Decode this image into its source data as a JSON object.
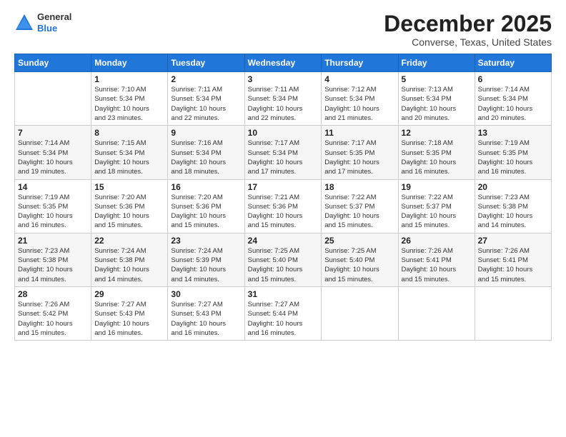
{
  "logo": {
    "general": "General",
    "blue": "Blue"
  },
  "title": "December 2025",
  "subtitle": "Converse, Texas, United States",
  "days_header": [
    "Sunday",
    "Monday",
    "Tuesday",
    "Wednesday",
    "Thursday",
    "Friday",
    "Saturday"
  ],
  "weeks": [
    [
      {
        "num": "",
        "info": ""
      },
      {
        "num": "1",
        "info": "Sunrise: 7:10 AM\nSunset: 5:34 PM\nDaylight: 10 hours\nand 23 minutes."
      },
      {
        "num": "2",
        "info": "Sunrise: 7:11 AM\nSunset: 5:34 PM\nDaylight: 10 hours\nand 22 minutes."
      },
      {
        "num": "3",
        "info": "Sunrise: 7:11 AM\nSunset: 5:34 PM\nDaylight: 10 hours\nand 22 minutes."
      },
      {
        "num": "4",
        "info": "Sunrise: 7:12 AM\nSunset: 5:34 PM\nDaylight: 10 hours\nand 21 minutes."
      },
      {
        "num": "5",
        "info": "Sunrise: 7:13 AM\nSunset: 5:34 PM\nDaylight: 10 hours\nand 20 minutes."
      },
      {
        "num": "6",
        "info": "Sunrise: 7:14 AM\nSunset: 5:34 PM\nDaylight: 10 hours\nand 20 minutes."
      }
    ],
    [
      {
        "num": "7",
        "info": "Sunrise: 7:14 AM\nSunset: 5:34 PM\nDaylight: 10 hours\nand 19 minutes."
      },
      {
        "num": "8",
        "info": "Sunrise: 7:15 AM\nSunset: 5:34 PM\nDaylight: 10 hours\nand 18 minutes."
      },
      {
        "num": "9",
        "info": "Sunrise: 7:16 AM\nSunset: 5:34 PM\nDaylight: 10 hours\nand 18 minutes."
      },
      {
        "num": "10",
        "info": "Sunrise: 7:17 AM\nSunset: 5:34 PM\nDaylight: 10 hours\nand 17 minutes."
      },
      {
        "num": "11",
        "info": "Sunrise: 7:17 AM\nSunset: 5:35 PM\nDaylight: 10 hours\nand 17 minutes."
      },
      {
        "num": "12",
        "info": "Sunrise: 7:18 AM\nSunset: 5:35 PM\nDaylight: 10 hours\nand 16 minutes."
      },
      {
        "num": "13",
        "info": "Sunrise: 7:19 AM\nSunset: 5:35 PM\nDaylight: 10 hours\nand 16 minutes."
      }
    ],
    [
      {
        "num": "14",
        "info": "Sunrise: 7:19 AM\nSunset: 5:35 PM\nDaylight: 10 hours\nand 16 minutes."
      },
      {
        "num": "15",
        "info": "Sunrise: 7:20 AM\nSunset: 5:36 PM\nDaylight: 10 hours\nand 15 minutes."
      },
      {
        "num": "16",
        "info": "Sunrise: 7:20 AM\nSunset: 5:36 PM\nDaylight: 10 hours\nand 15 minutes."
      },
      {
        "num": "17",
        "info": "Sunrise: 7:21 AM\nSunset: 5:36 PM\nDaylight: 10 hours\nand 15 minutes."
      },
      {
        "num": "18",
        "info": "Sunrise: 7:22 AM\nSunset: 5:37 PM\nDaylight: 10 hours\nand 15 minutes."
      },
      {
        "num": "19",
        "info": "Sunrise: 7:22 AM\nSunset: 5:37 PM\nDaylight: 10 hours\nand 15 minutes."
      },
      {
        "num": "20",
        "info": "Sunrise: 7:23 AM\nSunset: 5:38 PM\nDaylight: 10 hours\nand 14 minutes."
      }
    ],
    [
      {
        "num": "21",
        "info": "Sunrise: 7:23 AM\nSunset: 5:38 PM\nDaylight: 10 hours\nand 14 minutes."
      },
      {
        "num": "22",
        "info": "Sunrise: 7:24 AM\nSunset: 5:38 PM\nDaylight: 10 hours\nand 14 minutes."
      },
      {
        "num": "23",
        "info": "Sunrise: 7:24 AM\nSunset: 5:39 PM\nDaylight: 10 hours\nand 14 minutes."
      },
      {
        "num": "24",
        "info": "Sunrise: 7:25 AM\nSunset: 5:40 PM\nDaylight: 10 hours\nand 15 minutes."
      },
      {
        "num": "25",
        "info": "Sunrise: 7:25 AM\nSunset: 5:40 PM\nDaylight: 10 hours\nand 15 minutes."
      },
      {
        "num": "26",
        "info": "Sunrise: 7:26 AM\nSunset: 5:41 PM\nDaylight: 10 hours\nand 15 minutes."
      },
      {
        "num": "27",
        "info": "Sunrise: 7:26 AM\nSunset: 5:41 PM\nDaylight: 10 hours\nand 15 minutes."
      }
    ],
    [
      {
        "num": "28",
        "info": "Sunrise: 7:26 AM\nSunset: 5:42 PM\nDaylight: 10 hours\nand 15 minutes."
      },
      {
        "num": "29",
        "info": "Sunrise: 7:27 AM\nSunset: 5:43 PM\nDaylight: 10 hours\nand 16 minutes."
      },
      {
        "num": "30",
        "info": "Sunrise: 7:27 AM\nSunset: 5:43 PM\nDaylight: 10 hours\nand 16 minutes."
      },
      {
        "num": "31",
        "info": "Sunrise: 7:27 AM\nSunset: 5:44 PM\nDaylight: 10 hours\nand 16 minutes."
      },
      {
        "num": "",
        "info": ""
      },
      {
        "num": "",
        "info": ""
      },
      {
        "num": "",
        "info": ""
      }
    ]
  ]
}
